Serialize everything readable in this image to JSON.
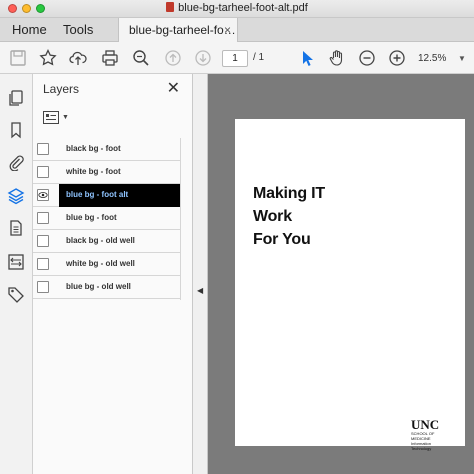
{
  "window": {
    "title": "blue-bg-tarheel-foot-alt.pdf"
  },
  "tabs": {
    "home": "Home",
    "tools": "Tools",
    "document": "blue-bg-tarheel-fo…",
    "close_glyph": "×"
  },
  "toolbar": {
    "icons": [
      "save-icon",
      "bookmark-star-icon",
      "upload-icon",
      "print-icon",
      "zoom-search-icon",
      "page-up-icon",
      "page-down-icon",
      "select-cursor-icon",
      "hand-icon",
      "zoom-out-icon",
      "zoom-in-icon"
    ],
    "page_current": "1",
    "page_total": "/ 1",
    "zoom": "12.5%"
  },
  "rail": {
    "icons": [
      "pages-icon",
      "bookmarks-icon",
      "attachments-icon",
      "layers-icon",
      "document-icon",
      "compare-icon",
      "tags-icon"
    ]
  },
  "layers_panel": {
    "title": "Layers",
    "close_glyph": "✕",
    "layers": [
      {
        "label": "black bg - foot",
        "selected": false
      },
      {
        "label": "white bg - foot",
        "selected": false
      },
      {
        "label": "blue bg - foot alt",
        "selected": true
      },
      {
        "label": "blue bg - foot",
        "selected": false
      },
      {
        "label": "black bg - old well",
        "selected": false
      },
      {
        "label": "white bg - old well",
        "selected": false
      },
      {
        "label": "blue bg - old well",
        "selected": false
      }
    ]
  },
  "document": {
    "heading_lines": [
      "Making IT",
      "Work",
      "For You"
    ],
    "logo": {
      "name": "UNC",
      "line1": "SCHOOL OF MEDICINE",
      "line2": "Information",
      "line3": "Technology"
    }
  },
  "colors": {
    "selection_bg": "#000000",
    "selection_text": "#8fc4ff",
    "workspace": "#7b7b7b",
    "select_tool": "#1473e6"
  }
}
